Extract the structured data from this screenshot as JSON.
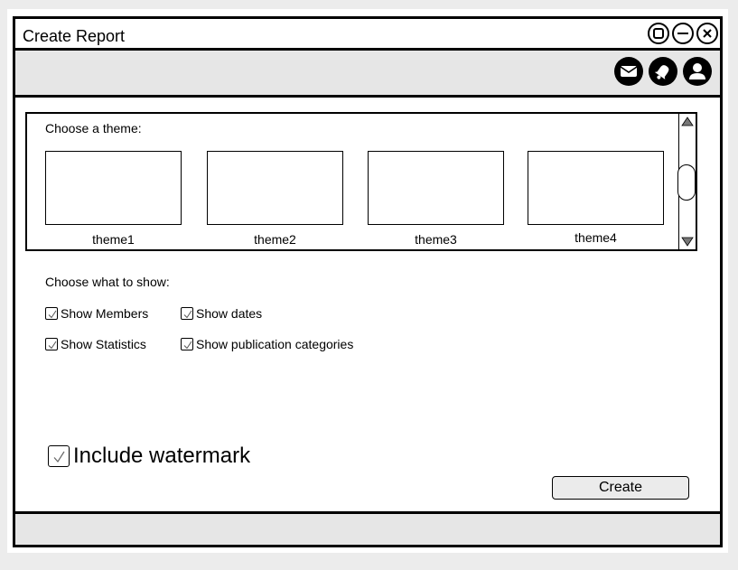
{
  "window": {
    "title": "Create Report"
  },
  "themes": {
    "label": "Choose a theme:",
    "items": [
      {
        "label": "theme1"
      },
      {
        "label": "theme2"
      },
      {
        "label": "theme3"
      },
      {
        "label": "theme4"
      }
    ]
  },
  "options": {
    "label": "Choose what to show:",
    "show_members": {
      "label": "Show Members",
      "checked": true
    },
    "show_dates": {
      "label": "Show dates",
      "checked": true
    },
    "show_statistics": {
      "label": "Show Statistics",
      "checked": true
    },
    "show_categories": {
      "label": "Show publication categories",
      "checked": true
    }
  },
  "watermark": {
    "label": "Include watermark",
    "checked": true
  },
  "actions": {
    "create_label": "Create"
  },
  "icons": {
    "maximize": "maximize-icon",
    "minimize": "minimize-icon",
    "close": "close-icon",
    "mail": "mail-icon",
    "notifications": "bell-icon",
    "profile": "user-icon"
  }
}
